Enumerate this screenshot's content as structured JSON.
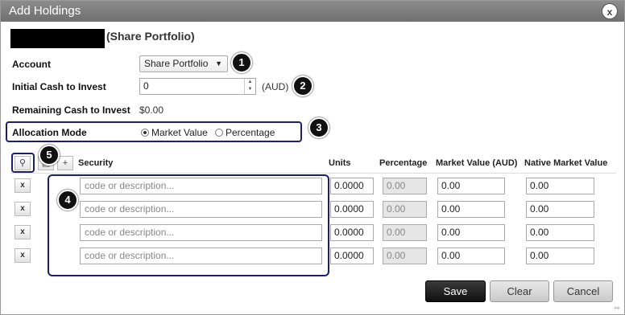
{
  "window": {
    "title": "Add Holdings",
    "close_label": "x"
  },
  "header": {
    "portfolio_suffix": "(Share Portfolio)"
  },
  "form": {
    "account_label": "Account",
    "account_value": "Share Portfolio",
    "initial_cash_label": "Initial Cash to Invest",
    "initial_cash_value": "0",
    "currency": "(AUD)",
    "remaining_cash_label": "Remaining Cash to Invest",
    "remaining_cash_value": "$0.00",
    "allocation_label": "Allocation Mode",
    "allocation_options": [
      "Market Value",
      "Percentage"
    ],
    "allocation_selected": "Market Value"
  },
  "callouts": [
    "1",
    "2",
    "3",
    "4",
    "5"
  ],
  "table": {
    "columns": [
      "Security",
      "Units",
      "Percentage",
      "Market Value (AUD)",
      "Native Market Value"
    ],
    "remove_label": "x",
    "add_label": "+",
    "rows": [
      {
        "security_placeholder": "code or description...",
        "units": "0.0000",
        "percentage": "0.00",
        "market_value": "0.00",
        "native_value": "0.00"
      },
      {
        "security_placeholder": "code or description...",
        "units": "0.0000",
        "percentage": "0.00",
        "market_value": "0.00",
        "native_value": "0.00"
      },
      {
        "security_placeholder": "code or description...",
        "units": "0.0000",
        "percentage": "0.00",
        "market_value": "0.00",
        "native_value": "0.00"
      },
      {
        "security_placeholder": "code or description...",
        "units": "0.0000",
        "percentage": "0.00",
        "market_value": "0.00",
        "native_value": "0.00"
      }
    ]
  },
  "footer": {
    "save_label": "Save",
    "clear_label": "Clear",
    "cancel_label": "Cancel"
  },
  "colors": {
    "highlight_border": "#1b1f6e",
    "titlebar": "#7d7d7d"
  }
}
